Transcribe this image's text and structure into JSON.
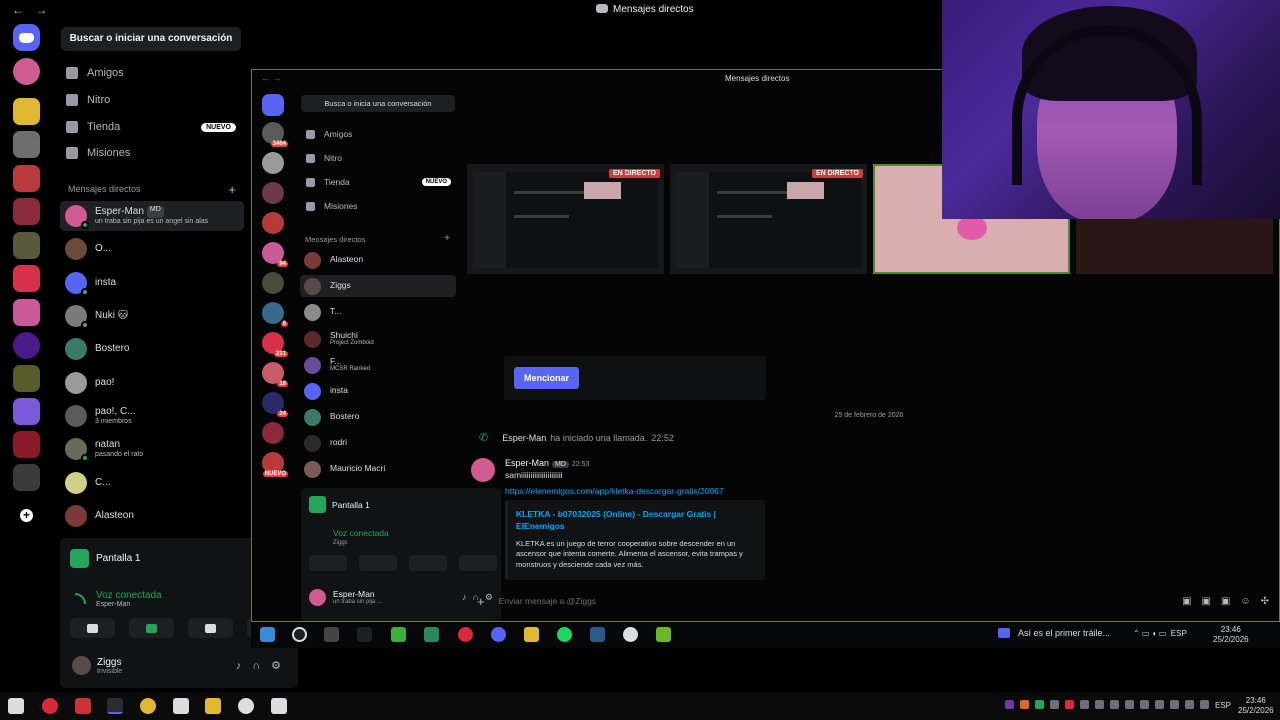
{
  "titlebar": {
    "back": "←",
    "forward": "→",
    "title": "Mensajes directos"
  },
  "sidebar": {
    "search": "Buscar o iniciar una conversación",
    "nav": [
      {
        "label": "Amigos",
        "icon": "friends-icon"
      },
      {
        "label": "Nitro",
        "icon": "nitro-icon"
      },
      {
        "label": "Tienda",
        "icon": "shop-icon",
        "badge": "NUEVO"
      },
      {
        "label": "Misiones",
        "icon": "quests-icon"
      }
    ],
    "dm_header": "Mensajes directos",
    "dms": [
      {
        "name": "Esper-Man",
        "tag": "MD",
        "sub": "un traba sin pija es un angel sin alas",
        "color": "#d05a92",
        "status": "#23a55a",
        "active": true
      },
      {
        "name": "O...",
        "sub": "",
        "color": "#6a4a3a",
        "status": ""
      },
      {
        "name": "insta",
        "sub": "",
        "color": "#5865f2",
        "status": "#80848e"
      },
      {
        "name": "Ñuki 🐱",
        "sub": "",
        "color": "#7a7a7a",
        "status": "#80848e"
      },
      {
        "name": "Bostero",
        "sub": "",
        "color": "#3a7a6a",
        "status": ""
      },
      {
        "name": "pao!",
        "sub": "",
        "color": "#9a9a9a",
        "status": ""
      },
      {
        "name": "pao!, C...",
        "sub": "3 miembros",
        "color": "#5a5a5a",
        "status": ""
      },
      {
        "name": "natan",
        "sub": "pasando el rato",
        "color": "#6a6a5a",
        "status": "#23a55a"
      },
      {
        "name": "C...",
        "sub": "",
        "color": "#cfcf8a",
        "status": ""
      },
      {
        "name": "Alasteon",
        "sub": "",
        "color": "#7a3a3a",
        "status": ""
      }
    ],
    "stream_panel": {
      "label": "Pantalla 1",
      "voice_status": "Voz conectada",
      "voice_user": "Esper-Man"
    },
    "user": {
      "name": "Ziggs",
      "status": "Invisible"
    }
  },
  "stream": {
    "title": "Mensajes directos",
    "nav": "← →",
    "search": "Busca o inicia una conversación",
    "nav_items": [
      {
        "label": "Amigos"
      },
      {
        "label": "Nitro"
      },
      {
        "label": "Tienda",
        "badge": "NUEVO"
      },
      {
        "label": "Misiones"
      }
    ],
    "dm_header": "Mensajes directos",
    "dms": [
      {
        "name": "Alasteon",
        "sub": "",
        "color": "#7a3a3a"
      },
      {
        "name": "Ziggs",
        "sub": "",
        "color": "#5a4a4a",
        "active": true
      },
      {
        "name": "T...",
        "sub": "",
        "color": "#8a8a8a"
      },
      {
        "name": "Shuichi",
        "sub": "Project Zomboid",
        "color": "#5a2a2a"
      },
      {
        "name": "F...",
        "sub": "MCSR Ranked",
        "color": "#6a4a9a"
      },
      {
        "name": "insta",
        "sub": "",
        "color": "#5865f2"
      },
      {
        "name": "Bostero",
        "sub": "",
        "color": "#3a7a6a"
      },
      {
        "name": "rodri",
        "sub": "",
        "color": "#2a2a2a"
      },
      {
        "name": "Mauricio Macri",
        "sub": "",
        "color": "#7a5a5a"
      }
    ],
    "rail_badges": [
      "3464",
      "94",
      "8",
      "221",
      "19",
      "24",
      "NUEVO"
    ],
    "panel": {
      "label": "Pantalla 1",
      "voice_status": "Voz conectada",
      "voice_user": "Ziggs",
      "user_name": "Esper-Man",
      "user_status": "un traba sin pija ..."
    },
    "thumb_live": "EN DIRECTO",
    "mention_button": "Mencionar",
    "date": "25 de febrero de 2026",
    "call": {
      "user": "Esper-Man",
      "text": "ha iniciado una llamada.",
      "time": "22:52"
    },
    "message": {
      "user": "Esper-Man",
      "tag": "MD",
      "time": "22:53",
      "body": "samiiiiiiiiiiiiiiiiiiiiii",
      "link": "https://elenemigos.com/app/kletka-descargar-gratis/20067",
      "embed_title": "KLETKA - b07032025 (Online) - Descargar Gratis | ElEnemigos",
      "embed_desc": "KLETKA es un juego de terror cooperativo sobre descender en un ascensor que intenta comerte. Alimenta el ascensor, evita trampas y monstruos y desciende cada vez más."
    },
    "composer_placeholder": "Enviar mensaje a @Ziggs",
    "taskbar": {
      "news": "Así es el primer tráile...",
      "lang": "ESP",
      "time": "23:46",
      "date": "25/2/2026"
    }
  },
  "taskbar": {
    "lang": "ESP",
    "time": "23:46",
    "date": "25/2/2026"
  }
}
